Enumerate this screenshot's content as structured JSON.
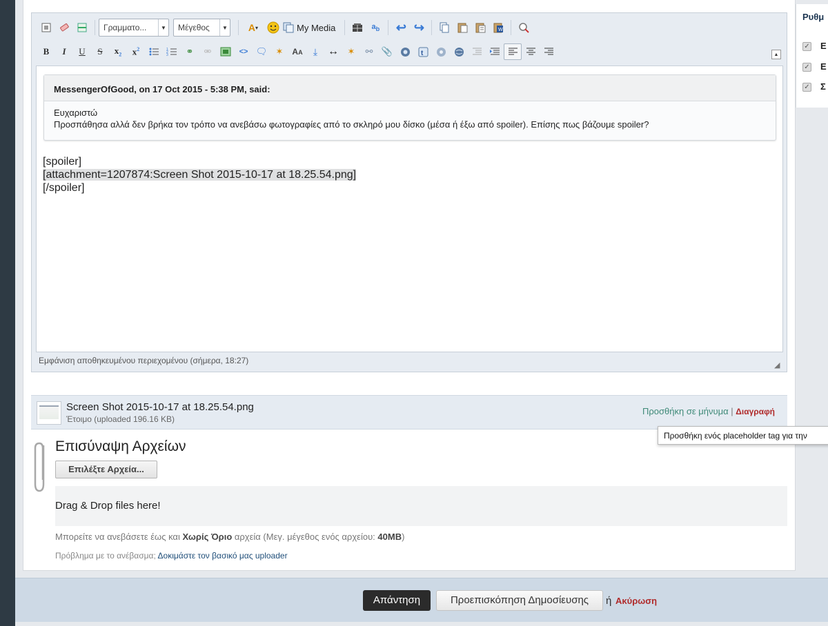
{
  "sidebar": {
    "title": "Ρυθμ",
    "options": [
      {
        "label": "Ε",
        "checked": true
      },
      {
        "label": "Ε",
        "checked": true
      },
      {
        "label": "Σ",
        "checked": true
      }
    ]
  },
  "toolbar": {
    "font_select": "Γραμματο...",
    "size_select": "Μέγεθος",
    "my_media": "My Media"
  },
  "editor": {
    "quote": {
      "header": "MessengerOfGood, on 17 Oct 2015 - 5:38 PM, said:",
      "line1": "Ευχαριστώ",
      "line2": "Προσπάθησα αλλά δεν βρήκα τον τρόπο να ανεβάσω φωτογραφίες από το σκληρό μου δίσκο (μέσα ή έξω από spoiler). Επίσης πως βάζουμε spoiler?"
    },
    "body_lines": [
      "[spoiler]",
      "[attachment=1207874:Screen Shot 2015-10-17 at 18.25.54.png]",
      "[/spoiler]"
    ],
    "status": "Εμφάνιση αποθηκευμένου περιεχομένου (σήμερα, 18:27)"
  },
  "attachment": {
    "filename": "Screen Shot 2015-10-17 at 18.25.54.png",
    "status": "Έτοιμο (uploaded 196.16 KB)",
    "add_label": "Προσθήκη σε μήνυμα",
    "separator": "|",
    "delete_label": "Διαγραφή"
  },
  "tooltip": "Προσθήκη ενός placeholder tag για την",
  "upload": {
    "title": "Επισύναψη Αρχείων",
    "choose_button": "Επιλέξτε Αρχεία...",
    "dropzone": "Drag & Drop files here!",
    "limits_prefix": "Μπορείτε να ανεβάσετε έως και ",
    "limits_bold": "Χωρίς Όριο",
    "limits_mid": " αρχεία (Μεγ. μέγεθος ενός αρχείου: ",
    "limits_size": "40MB",
    "limits_suffix": ")",
    "problem_prefix": "Πρόβλημα με το ανέβασμα; ",
    "problem_link": "Δοκιμάστε τον βασικό μας uploader"
  },
  "footer": {
    "submit": "Απάντηση",
    "preview": "Προεπισκόπηση Δημοσίευσης",
    "or": "ή",
    "cancel": "Ακύρωση"
  }
}
